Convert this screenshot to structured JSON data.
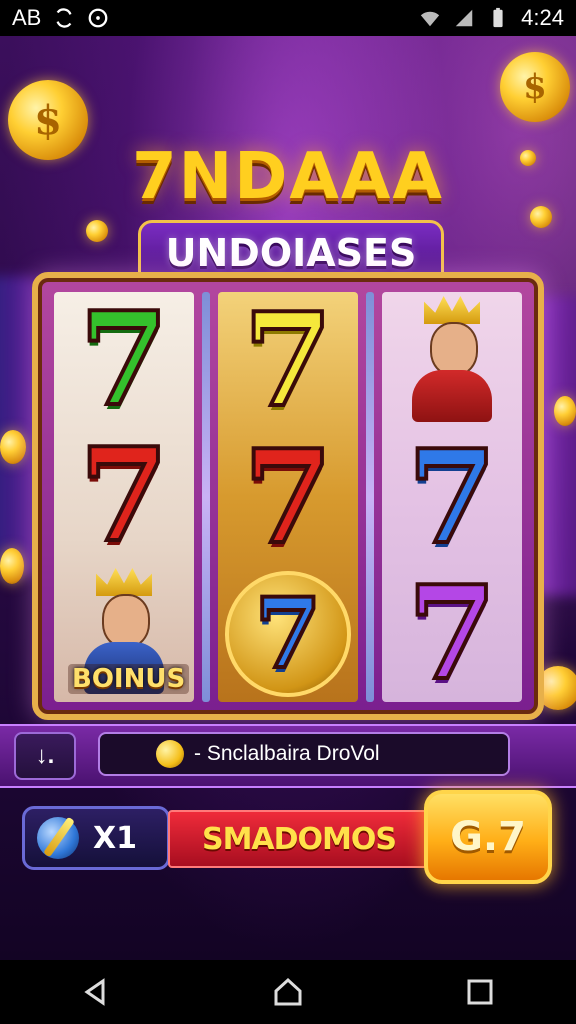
{
  "status_bar": {
    "left_text": "AB",
    "time": "4:24"
  },
  "game": {
    "title": "7NDAAA",
    "subtitle": "UNDOIASES",
    "reels": [
      {
        "symbols": [
          "7 green",
          "7 red",
          "king"
        ],
        "label": "BOINUS"
      },
      {
        "symbols": [
          "7 yellow",
          "7 red",
          "7 blue medallion"
        ]
      },
      {
        "symbols": [
          "king",
          "7 blue",
          "7 purple"
        ]
      }
    ],
    "info_button_label": "↓.",
    "info_text": "- Snclalbaira DroVol",
    "bet_value": "X1",
    "action_label": "SMADOMOS",
    "spin_label": "G.7"
  },
  "icons": {
    "status": [
      "sync-icon",
      "circle-icon",
      "wifi-icon",
      "signal-icon",
      "battery-icon"
    ],
    "nav": [
      "back-icon",
      "home-icon",
      "recents-icon"
    ]
  },
  "colors": {
    "gold": "#ffcf1f",
    "purple_bg": "#3b0f5c",
    "red_bar": "#ef2b3a",
    "spin_orange": "#ffae17"
  }
}
